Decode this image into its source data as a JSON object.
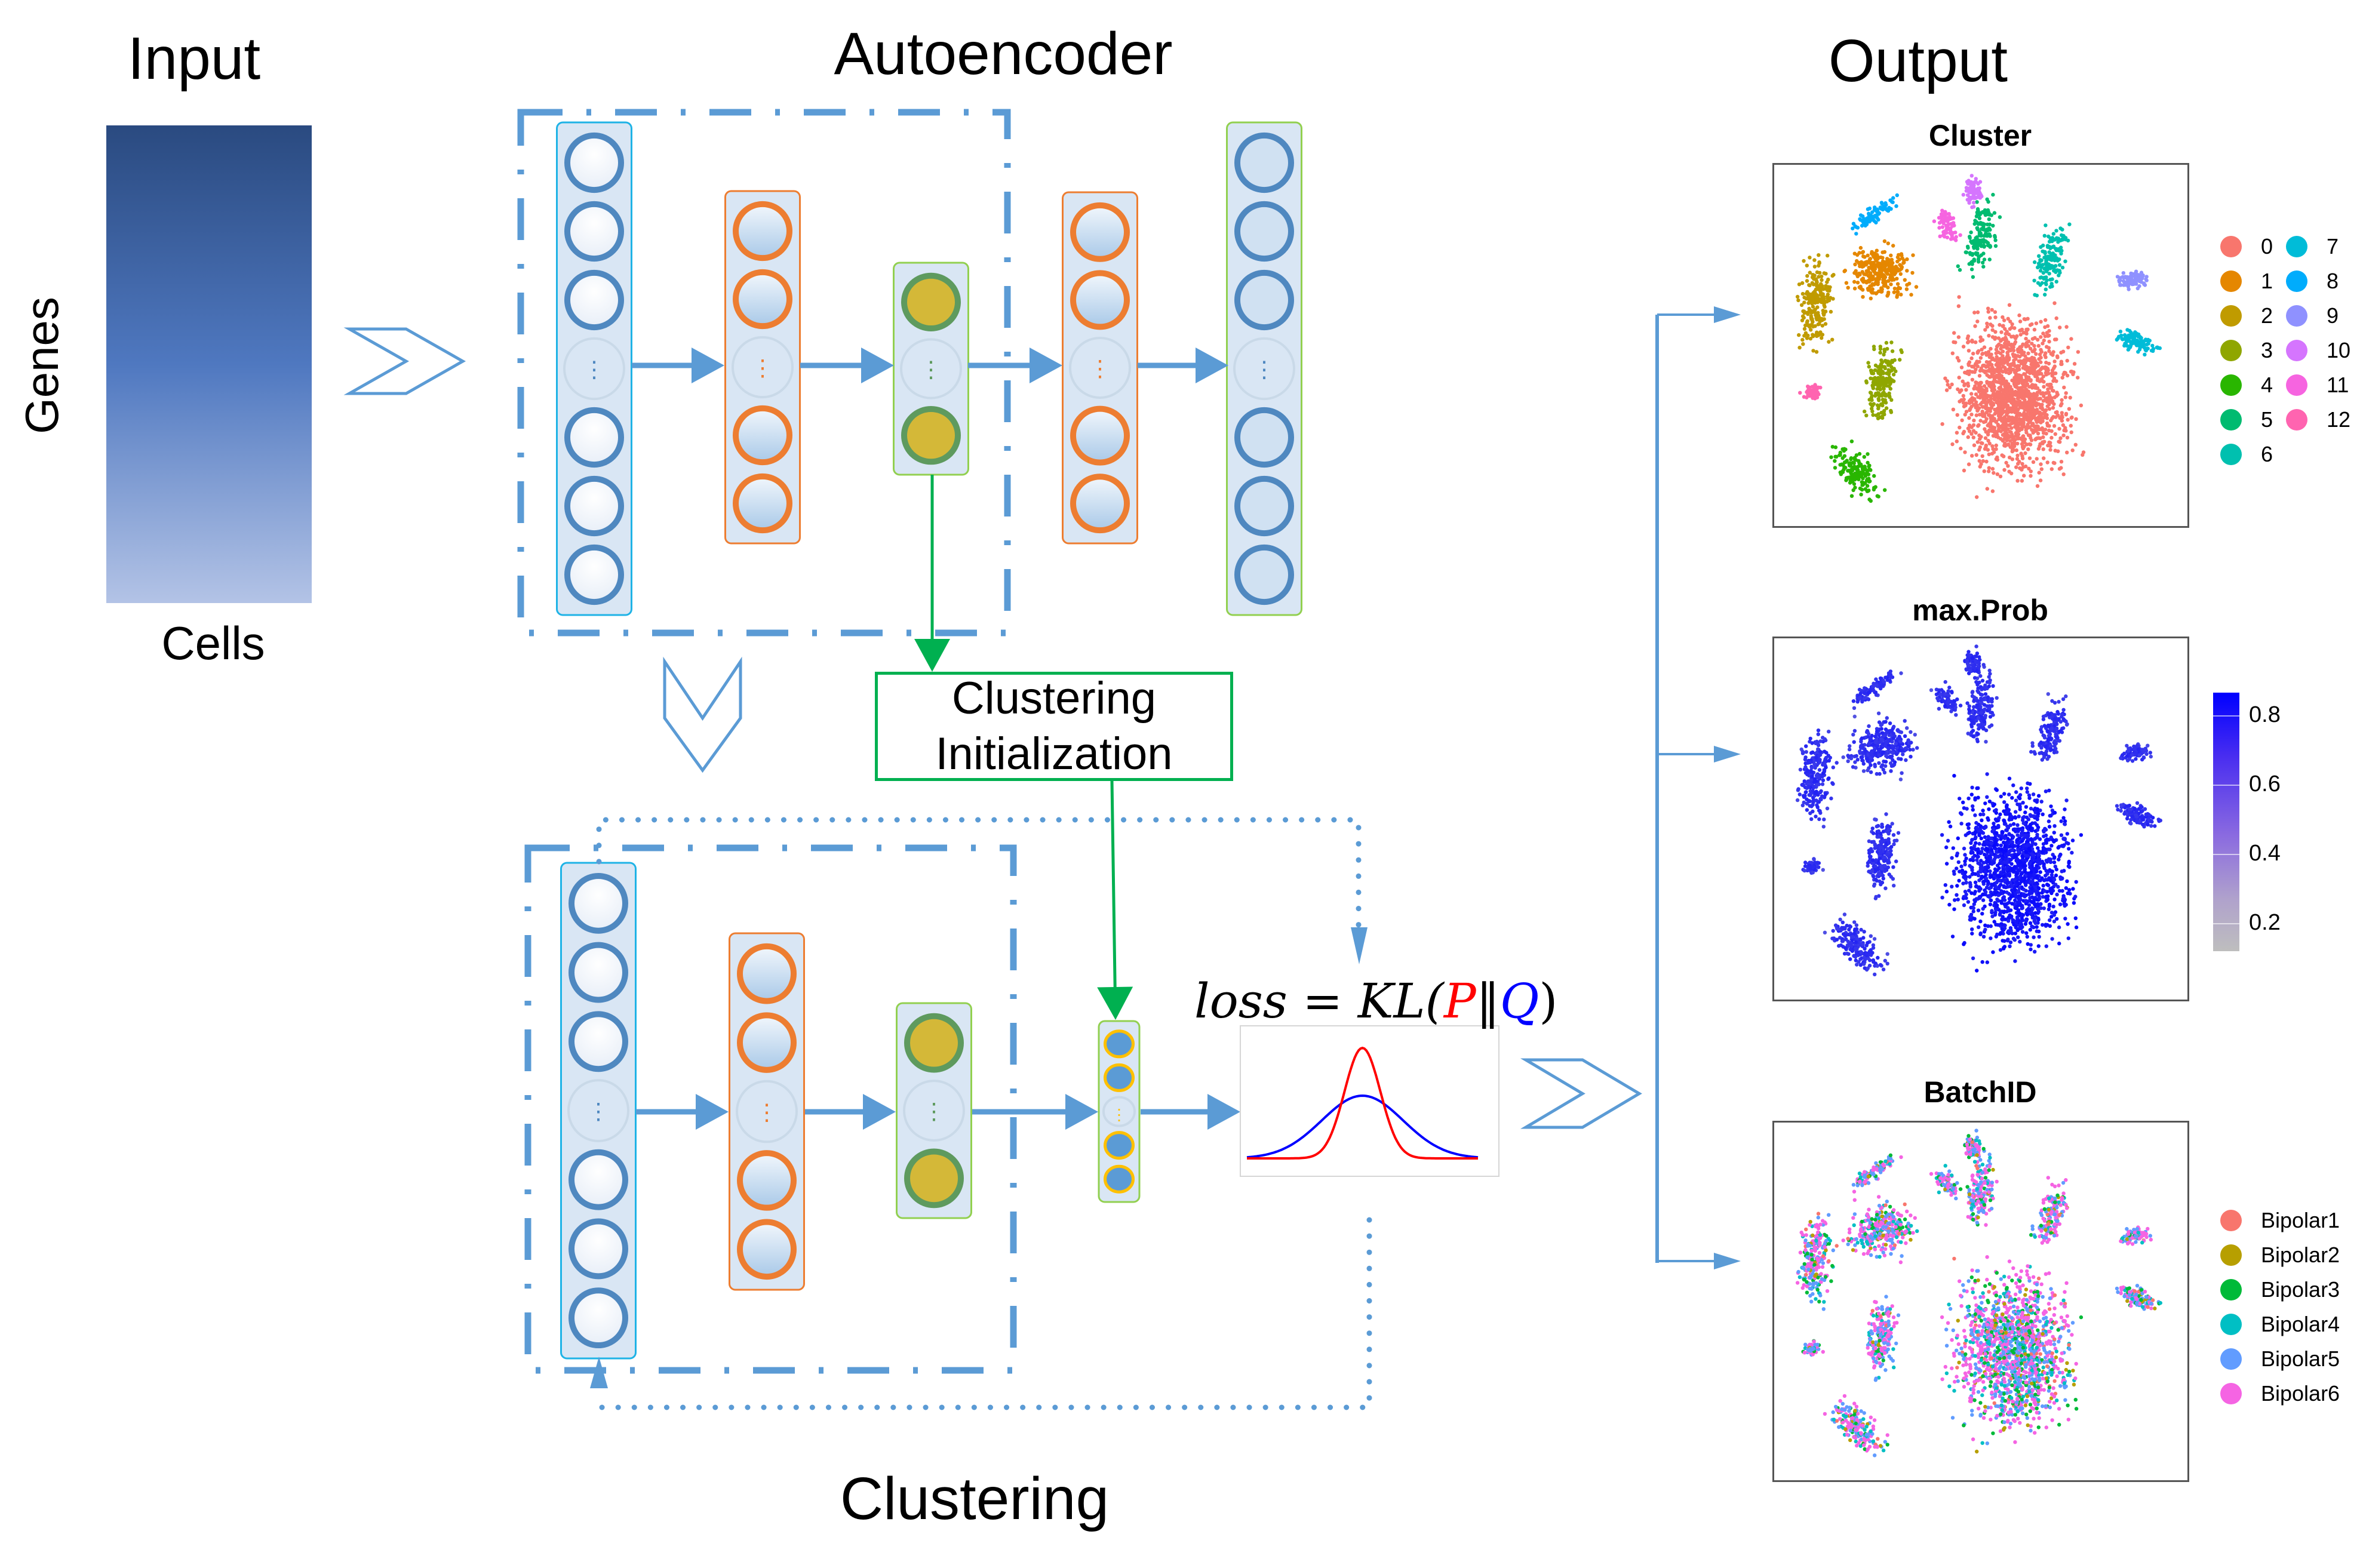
{
  "titles": {
    "input": "Input",
    "autoencoder": "Autoencoder",
    "output": "Output",
    "clustering": "Clustering"
  },
  "input_matrix": {
    "row_label": "Genes",
    "col_label": "Cells",
    "gradient_top": "#2a4a80",
    "gradient_bottom": "#b3c3e6"
  },
  "init_box": {
    "line1": "Clustering",
    "line2": "Initialization"
  },
  "loss": {
    "lhs": "loss",
    "eq": " = ",
    "kl": "KL(",
    "p": "P",
    "sep": "‖",
    "q": "Q",
    "close": ")",
    "p_color": "#ff0000",
    "q_color": "#0000ff"
  },
  "network": {
    "input_layer_color": "#4f88c0",
    "hidden_layer_color": "#ed7d31",
    "bottleneck_fill": "#d4b838",
    "bottleneck_stroke": "#5e9a5e",
    "cluster_fill": "#5b9bd5",
    "cluster_stroke": "#ffc000",
    "arrow_color": "#5b9bd5",
    "init_arrow_color": "#00b050",
    "ellipsis": "⋮"
  },
  "plots": [
    {
      "title": "Cluster",
      "legend_type": "categorical",
      "legend": [
        {
          "label": "0",
          "color": "#f8766d"
        },
        {
          "label": "1",
          "color": "#e58700"
        },
        {
          "label": "2",
          "color": "#c09b00"
        },
        {
          "label": "3",
          "color": "#8fa600"
        },
        {
          "label": "4",
          "color": "#29b600"
        },
        {
          "label": "5",
          "color": "#00bb70"
        },
        {
          "label": "6",
          "color": "#00c0af"
        },
        {
          "label": "7",
          "color": "#00bcd8"
        },
        {
          "label": "8",
          "color": "#00acfc"
        },
        {
          "label": "9",
          "color": "#8f91ff"
        },
        {
          "label": "10",
          "color": "#d575fe"
        },
        {
          "label": "11",
          "color": "#f664e0"
        },
        {
          "label": "12",
          "color": "#ff64b0"
        }
      ]
    },
    {
      "title": "max.Prob",
      "legend_type": "continuous",
      "colorbar_ticks": [
        "0.8",
        "0.6",
        "0.4",
        "0.2"
      ],
      "colorbar_low": "#bebebe",
      "colorbar_high": "#0000ff"
    },
    {
      "title": "BatchID",
      "legend_type": "categorical",
      "legend": [
        {
          "label": "Bipolar1",
          "color": "#f8766d"
        },
        {
          "label": "Bipolar2",
          "color": "#b79f00"
        },
        {
          "label": "Bipolar3",
          "color": "#00ba38"
        },
        {
          "label": "Bipolar4",
          "color": "#00bfc4"
        },
        {
          "label": "Bipolar5",
          "color": "#619cff"
        },
        {
          "label": "Bipolar6",
          "color": "#f564e3"
        }
      ]
    }
  ]
}
